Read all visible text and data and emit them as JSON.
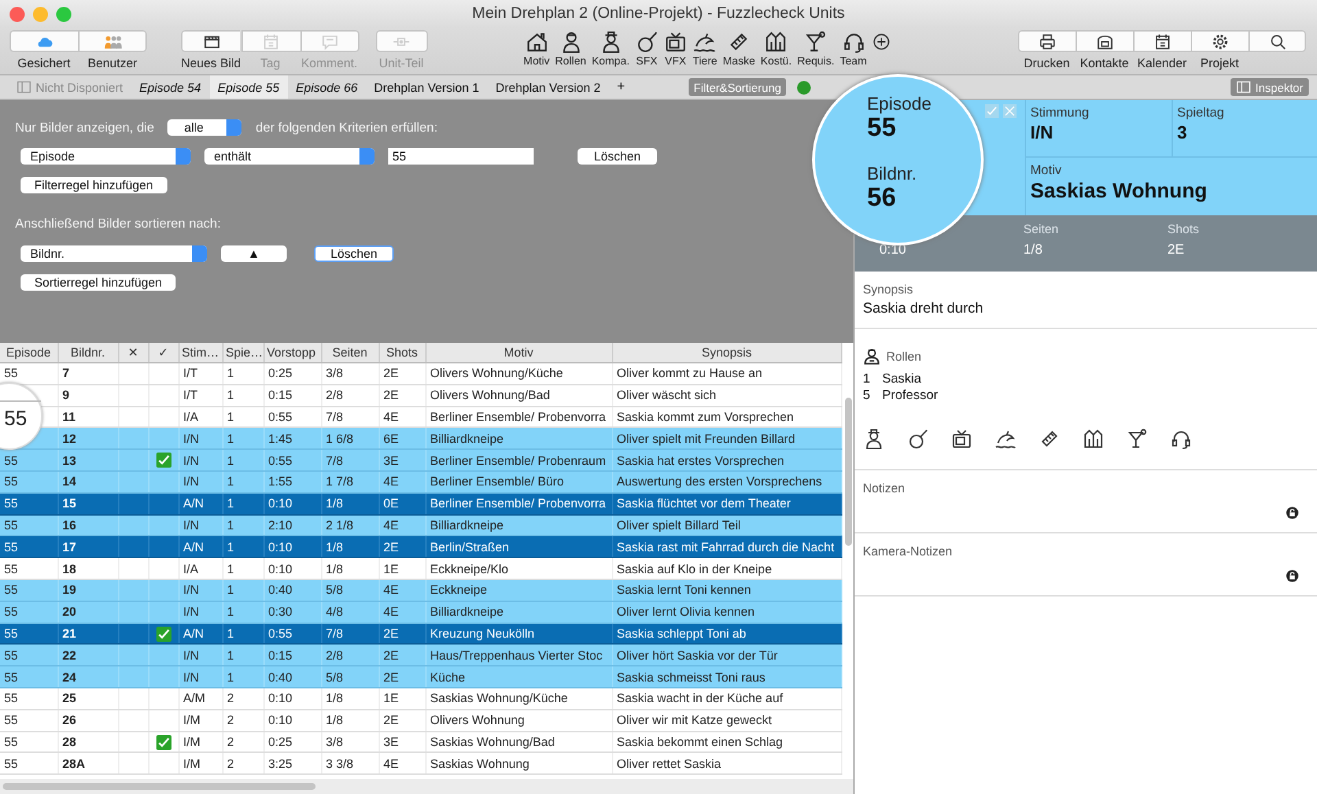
{
  "window": {
    "title": "Mein Drehplan 2 (Online-Projekt) - Fuzzlecheck Units"
  },
  "toolbar": {
    "groups": [
      {
        "kind": "segmented",
        "items": [
          {
            "label": "Gesichert",
            "disabled": false
          },
          {
            "label": "Benutzer",
            "disabled": false
          }
        ]
      },
      {
        "kind": "segmented",
        "items": [
          {
            "label": "Neues Bild",
            "disabled": false
          },
          {
            "label": "Tag",
            "disabled": true
          },
          {
            "label": "Komment.",
            "disabled": true
          }
        ]
      },
      {
        "kind": "segmented",
        "items": [
          {
            "label": "Unit-Teil",
            "disabled": true
          }
        ]
      },
      {
        "kind": "plain",
        "items": [
          {
            "label": "Motiv",
            "disabled": false
          },
          {
            "label": "Rollen",
            "disabled": false
          },
          {
            "label": "Kompa.",
            "disabled": false
          },
          {
            "label": "SFX",
            "disabled": false
          },
          {
            "label": "VFX",
            "disabled": false
          },
          {
            "label": "Tiere",
            "disabled": false
          },
          {
            "label": "Maske",
            "disabled": false
          },
          {
            "label": "Kostü.",
            "disabled": false
          },
          {
            "label": "Requis.",
            "disabled": false
          },
          {
            "label": "Team",
            "disabled": false
          },
          {
            "disabled": false
          }
        ]
      },
      {
        "kind": "segmented",
        "items": [
          {
            "label": "Drucken",
            "disabled": false
          },
          {
            "label": "Kontakte",
            "disabled": false
          },
          {
            "label": "Kalender",
            "disabled": false
          },
          {
            "label": "Projekt",
            "disabled": false
          },
          {
            "disabled": false
          }
        ]
      }
    ]
  },
  "tabs": [
    {
      "label": "Nicht Disponiert",
      "kind": "pool",
      "selected": false
    },
    {
      "label": "Episode 54",
      "kind": "episode",
      "selected": false
    },
    {
      "label": "Episode 55",
      "kind": "episode",
      "selected": true
    },
    {
      "label": "Episode 66",
      "kind": "episode",
      "selected": false
    },
    {
      "label": "Drehplan Version 1",
      "kind": "version",
      "selected": false
    },
    {
      "label": "Drehplan Version 2",
      "kind": "version",
      "selected": false
    }
  ],
  "add_tab": "+",
  "filter_button": "Filter&Sortierung",
  "inspector_button": "Inspektor",
  "filter": {
    "intro_before": "Nur Bilder anzeigen, die",
    "match": "alle",
    "intro_after": "der folgenden Kriterien erfüllen:",
    "rules": [
      {
        "field": "Episode",
        "operator": "enthält",
        "value": "55",
        "delete": "Löschen"
      }
    ],
    "add_rule": "Filterregel hinzufügen",
    "sort_intro": "Anschließend Bilder sortieren nach:",
    "sort_rules": [
      {
        "field": "Bildnr.",
        "direction": "▲",
        "delete": "Löschen"
      }
    ],
    "add_sort": "Sortierregel hinzufügen"
  },
  "table": {
    "columns": [
      "Episode",
      "Bildnr.",
      "✕",
      "✓",
      "Stim…",
      "Spie…",
      "Vorstopp",
      "Seiten",
      "Shots",
      "Motiv",
      "Synopsis"
    ],
    "lens": "55",
    "rows": [
      {
        "episode": "55",
        "number": "7",
        "done": false,
        "mood": "I/T",
        "day": "1",
        "duration": "0:25",
        "pages": "3/8",
        "shots": "2E",
        "motif": "Olivers Wohnung/Küche",
        "synopsis": "Oliver kommt zu Hause an",
        "marked": false,
        "selected": false
      },
      {
        "number": "9",
        "done": false,
        "mood": "I/T",
        "day": "1",
        "duration": "0:15",
        "pages": "2/8",
        "shots": "2E",
        "motif": "Olivers Wohnung/Bad",
        "synopsis": "Oliver  wäscht sich",
        "marked": false,
        "selected": false
      },
      {
        "number": "11",
        "done": false,
        "mood": "I/A",
        "day": "1",
        "duration": "0:55",
        "pages": "7/8",
        "shots": "4E",
        "motif": "Berliner Ensemble/ Probenvorra",
        "synopsis": "Saskia kommt zum Vorsprechen",
        "marked": false,
        "selected": false
      },
      {
        "number": "12",
        "done": false,
        "mood": "I/N",
        "day": "1",
        "duration": "1:45",
        "pages": "1 6/8",
        "shots": "6E",
        "motif": "Billiardkneipe",
        "synopsis": "Oliver spielt mit Freunden Billard",
        "marked": true,
        "selected": false
      },
      {
        "episode": "55",
        "number": "13",
        "done": true,
        "mood": "I/N",
        "day": "1",
        "duration": "0:55",
        "pages": "7/8",
        "shots": "3E",
        "motif": "Berliner Ensemble/ Probenraum",
        "synopsis": "Saskia hat erstes Vorsprechen",
        "marked": true,
        "selected": false
      },
      {
        "episode": "55",
        "number": "14",
        "done": false,
        "mood": "I/N",
        "day": "1",
        "duration": "1:55",
        "pages": "1 7/8",
        "shots": "4E",
        "motif": "Berliner Ensemble/ Büro",
        "synopsis": "Auswertung des ersten Vorsprechens",
        "marked": true,
        "selected": false
      },
      {
        "episode": "55",
        "number": "15",
        "done": false,
        "mood": "A/N",
        "day": "1",
        "duration": "0:10",
        "pages": "1/8",
        "shots": "0E",
        "motif": "Berliner Ensemble/ Probenvorra",
        "synopsis": "Saskia flüchtet vor dem Theater",
        "marked": false,
        "selected": true
      },
      {
        "episode": "55",
        "number": "16",
        "done": false,
        "mood": "I/N",
        "day": "1",
        "duration": "2:10",
        "pages": "2 1/8",
        "shots": "4E",
        "motif": "Billiardkneipe",
        "synopsis": "Oliver spielt Billard Teil",
        "marked": true,
        "selected": false
      },
      {
        "episode": "55",
        "number": "17",
        "done": false,
        "mood": "A/N",
        "day": "1",
        "duration": "0:10",
        "pages": "1/8",
        "shots": "2E",
        "motif": "Berlin/Straßen",
        "synopsis": "Saskia rast mit Fahrrad durch die Nacht",
        "marked": false,
        "selected": true
      },
      {
        "episode": "55",
        "number": "18",
        "done": false,
        "mood": "I/A",
        "day": "1",
        "duration": "0:10",
        "pages": "1/8",
        "shots": "1E",
        "motif": "Eckkneipe/Klo",
        "synopsis": "Saskia auf Klo in der Kneipe",
        "marked": false,
        "selected": false
      },
      {
        "episode": "55",
        "number": "19",
        "done": false,
        "mood": "I/N",
        "day": "1",
        "duration": "0:40",
        "pages": "5/8",
        "shots": "4E",
        "motif": "Eckkneipe",
        "synopsis": "Saskia lernt Toni kennen",
        "marked": true,
        "selected": false
      },
      {
        "episode": "55",
        "number": "20",
        "done": false,
        "mood": "I/N",
        "day": "1",
        "duration": "0:30",
        "pages": "4/8",
        "shots": "4E",
        "motif": "Billiardkneipe",
        "synopsis": "Oliver lernt Olivia kennen",
        "marked": true,
        "selected": false
      },
      {
        "episode": "55",
        "number": "21",
        "done": true,
        "mood": "A/N",
        "day": "1",
        "duration": "0:55",
        "pages": "7/8",
        "shots": "2E",
        "motif": "Kreuzung Neukölln",
        "synopsis": "Saskia schleppt Toni ab",
        "marked": false,
        "selected": true
      },
      {
        "episode": "55",
        "number": "22",
        "done": false,
        "mood": "I/N",
        "day": "1",
        "duration": "0:15",
        "pages": "2/8",
        "shots": "2E",
        "motif": "Haus/Treppenhaus Vierter Stoc",
        "synopsis": "Oliver hört Saskia vor der Tür",
        "marked": true,
        "selected": false
      },
      {
        "episode": "55",
        "number": "24",
        "done": false,
        "mood": "I/N",
        "day": "1",
        "duration": "0:40",
        "pages": "5/8",
        "shots": "2E",
        "motif": "Küche",
        "synopsis": "Saskia schmeisst Toni raus",
        "marked": true,
        "selected": false
      },
      {
        "episode": "55",
        "number": "25",
        "done": false,
        "mood": "A/M",
        "day": "2",
        "duration": "0:10",
        "pages": "1/8",
        "shots": "1E",
        "motif": "Saskias Wohnung/Küche",
        "synopsis": "Saskia wacht in der Küche auf",
        "marked": false,
        "selected": false
      },
      {
        "episode": "55",
        "number": "26",
        "done": false,
        "mood": "I/M",
        "day": "2",
        "duration": "0:10",
        "pages": "1/8",
        "shots": "2E",
        "motif": "Olivers Wohnung",
        "synopsis": "Oliver wir mit Katze geweckt",
        "marked": false,
        "selected": false
      },
      {
        "episode": "55",
        "number": "28",
        "done": true,
        "mood": "I/M",
        "day": "2",
        "duration": "0:25",
        "pages": "3/8",
        "shots": "3E",
        "motif": "Saskias Wohnung/Bad",
        "synopsis": "Saskia bekommt einen Schlag",
        "marked": false,
        "selected": false
      },
      {
        "episode": "55",
        "number": "28A",
        "done": false,
        "mood": "I/M",
        "day": "2",
        "duration": "3:25",
        "pages": "3 3/8",
        "shots": "4E",
        "motif": "Saskias Wohnung",
        "synopsis": "Oliver rettet Saskia",
        "marked": false,
        "selected": false
      }
    ]
  },
  "inspector": {
    "episode_label": "Episode",
    "episode": "55",
    "number_label": "Bildnr.",
    "number": "56",
    "mood_label": "Stimmung",
    "mood": "I/N",
    "day_label": "Spieltag",
    "day": "3",
    "motif_label": "Motiv",
    "motif": "Saskias Wohnung",
    "stats": [
      {
        "value": "0:10"
      },
      {
        "label": "Seiten",
        "value": "1/8"
      },
      {
        "label": "Shots",
        "value": "2E"
      }
    ],
    "synopsis_label": "Synopsis",
    "synopsis": "Saskia dreht durch",
    "roles_label": "Rollen",
    "roles": [
      {
        "number": "1",
        "name": "Saskia"
      },
      {
        "number": "5",
        "name": "Professor"
      }
    ],
    "notes": [
      {
        "label": "Notizen"
      },
      {
        "label": "Kamera-Notizen"
      }
    ]
  }
}
